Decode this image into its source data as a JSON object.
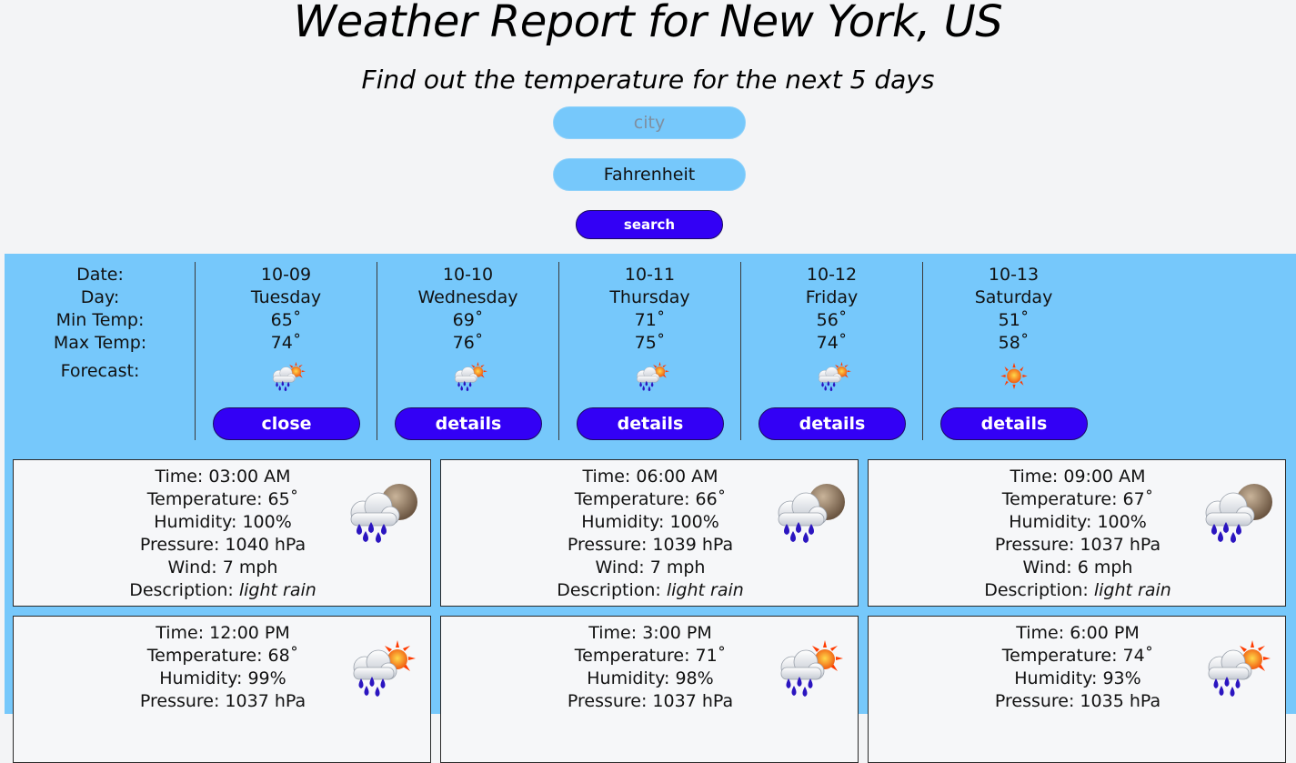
{
  "header": {
    "title": "Weather Report for New York, US",
    "subtitle": "Find out the temperature for the next 5 days"
  },
  "search": {
    "city_placeholder": "city",
    "unit_value": "Fahrenheit",
    "button_label": "search"
  },
  "labels": {
    "date": "Date:",
    "day": "Day:",
    "min": "Min Temp:",
    "max": "Max Temp:",
    "forecast": "Forecast:"
  },
  "days": [
    {
      "date": "10-09",
      "day": "Tuesday",
      "min": "65˚",
      "max": "74˚",
      "icon": "rain-sun-icon",
      "button": "close"
    },
    {
      "date": "10-10",
      "day": "Wednesday",
      "min": "69˚",
      "max": "76˚",
      "icon": "rain-sun-icon",
      "button": "details"
    },
    {
      "date": "10-11",
      "day": "Thursday",
      "min": "71˚",
      "max": "75˚",
      "icon": "rain-sun-icon",
      "button": "details"
    },
    {
      "date": "10-12",
      "day": "Friday",
      "min": "56˚",
      "max": "74˚",
      "icon": "rain-sun-icon",
      "button": "details"
    },
    {
      "date": "10-13",
      "day": "Saturday",
      "min": "51˚",
      "max": "58˚",
      "icon": "sun-icon",
      "button": "details"
    }
  ],
  "hourly": [
    {
      "time": "Time: 03:00 AM",
      "temp": "Temperature: 65˚",
      "humidity": "Humidity: 100%",
      "pressure": "Pressure: 1040 hPa",
      "wind": "Wind: 7 mph",
      "desc_label": "Description: ",
      "desc": "light rain",
      "icon": "rain-moon-icon"
    },
    {
      "time": "Time: 06:00 AM",
      "temp": "Temperature: 66˚",
      "humidity": "Humidity: 100%",
      "pressure": "Pressure: 1039 hPa",
      "wind": "Wind: 7 mph",
      "desc_label": "Description: ",
      "desc": "light rain",
      "icon": "rain-moon-icon"
    },
    {
      "time": "Time: 09:00 AM",
      "temp": "Temperature: 67˚",
      "humidity": "Humidity: 100%",
      "pressure": "Pressure: 1037 hPa",
      "wind": "Wind: 6 mph",
      "desc_label": "Description: ",
      "desc": "light rain",
      "icon": "rain-moon-icon"
    },
    {
      "time": "Time: 12:00 PM",
      "temp": "Temperature: 68˚",
      "humidity": "Humidity: 99%",
      "pressure": "Pressure: 1037 hPa",
      "icon": "rain-sun-icon"
    },
    {
      "time": "Time: 3:00 PM",
      "temp": "Temperature: 71˚",
      "humidity": "Humidity: 98%",
      "pressure": "Pressure: 1037 hPa",
      "icon": "rain-sun-icon"
    },
    {
      "time": "Time: 6:00 PM",
      "temp": "Temperature: 74˚",
      "humidity": "Humidity: 93%",
      "pressure": "Pressure: 1035 hPa",
      "icon": "rain-sun-icon"
    }
  ],
  "colors": {
    "panel": "#76c8fb",
    "button": "#3300f5",
    "page_bg": "#f3f4f6"
  }
}
